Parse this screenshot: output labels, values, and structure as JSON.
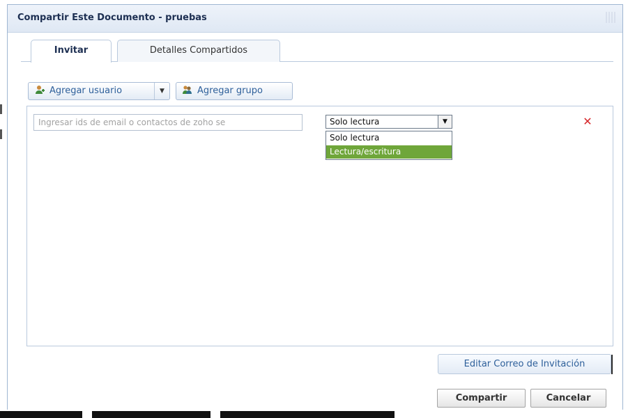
{
  "dialog": {
    "title": "Compartir Este Documento - pruebas"
  },
  "tabs": [
    {
      "label": "Invitar",
      "active": true
    },
    {
      "label": "Detalles Compartidos",
      "active": false
    }
  ],
  "toolbar": {
    "add_user_label": "Agregar usuario",
    "add_group_label": "Agregar grupo",
    "add_user_icon": "user-add-icon",
    "add_group_icon": "group-add-icon"
  },
  "invite_row": {
    "email_placeholder": "Ingresar ids de email o contactos de zoho se",
    "permission": {
      "selected": "Solo lectura",
      "options": [
        "Solo lectura",
        "Lectura/escritura"
      ],
      "highlighted": "Lectura/escritura"
    },
    "remove_icon": "remove-icon"
  },
  "buttons": {
    "edit_invitation": "Editar Correo de Invitación",
    "share": "Compartir",
    "cancel": "Cancelar"
  },
  "colors": {
    "accent": "#2d5f9a",
    "title": "#1d2f52",
    "option_highlight": "#6fa63a",
    "remove": "#d6282b"
  }
}
